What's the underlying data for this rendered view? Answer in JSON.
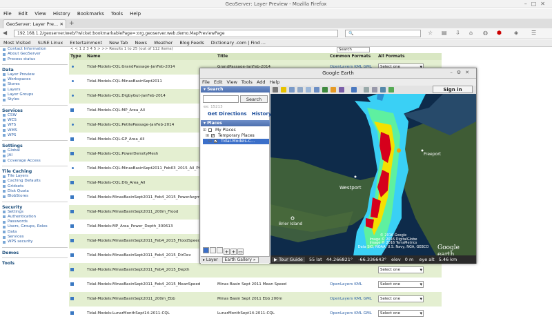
{
  "browser": {
    "window_title": "GeoServer: Layer Preview - Mozilla Firefox",
    "menu": [
      "File",
      "Edit",
      "View",
      "History",
      "Bookmarks",
      "Tools",
      "Help"
    ],
    "tab_label": "GeoServer: Layer Pre...",
    "url": "192.168.1.2/geoserver/web/?wicket:bookmarkablePage=:org.geoserver.web.demo.MapPreviewPage",
    "bookmarks": [
      "Most Visited",
      "SUSE Linux",
      "Entertainment",
      "New Tab",
      "News",
      "Weather",
      "Blog Feeds",
      "Dictionary .com | Find ..."
    ]
  },
  "sidebar": {
    "top_items": [
      "Contact Information",
      "About GeoServer",
      "Process status"
    ],
    "sections": [
      {
        "title": "Data",
        "items": [
          "Layer Preview",
          "Workspaces",
          "Stores",
          "Layers",
          "Layer Groups",
          "Styles"
        ]
      },
      {
        "title": "Services",
        "items": [
          "CSW",
          "WCS",
          "WFS",
          "WMS",
          "WPS"
        ]
      },
      {
        "title": "Settings",
        "items": [
          "Global",
          "JAI",
          "Coverage Access"
        ]
      },
      {
        "title": "Tile Caching",
        "items": [
          "Tile Layers",
          "Caching Defaults",
          "Gridsets",
          "Disk Quota",
          "BlobStores"
        ]
      },
      {
        "title": "Security",
        "items": [
          "Settings",
          "Authentication",
          "Passwords",
          "Users, Groups, Roles",
          "Data",
          "Services",
          "WPS security"
        ]
      },
      {
        "title": "Demos",
        "items": []
      },
      {
        "title": "Tools",
        "items": []
      }
    ]
  },
  "table": {
    "pager": "< < 1 2 3 4 5 > >> Results 1 to 25 (out of 112 items)",
    "search_label": "Search",
    "headers": {
      "type": "Type",
      "name": "Name",
      "title": "Title",
      "common": "Common Formats",
      "all": "All Formats"
    },
    "select_label": "Select one",
    "rows": [
      {
        "type": "point",
        "name": "Tidal-Models-CQL:GrandPassage-JanFeb-2014",
        "title": "GrandPassage-JanFeb-2014",
        "links": "OpenLayers KML GML"
      },
      {
        "type": "point",
        "name": "Tidal-Models-CQL:MinasBasinSept2011",
        "title": "",
        "links": ""
      },
      {
        "type": "point",
        "name": "Tidal-Models-CQL:DigbyGut-JanFeb-2014",
        "title": "",
        "links": ""
      },
      {
        "type": "polygon",
        "name": "Tidal-Models-CQL:MP_Area_All",
        "title": "",
        "links": ""
      },
      {
        "type": "point",
        "name": "Tidal-Models-CQL:PetitePassage-JanFeb-2014",
        "title": "",
        "links": ""
      },
      {
        "type": "polygon",
        "name": "Tidal-Models-CQL:GP_Area_All",
        "title": "",
        "links": ""
      },
      {
        "type": "polygon",
        "name": "Tidal-Models-CQL:PowerDensityMesh",
        "title": "",
        "links": ""
      },
      {
        "type": "point",
        "name": "Tidal-Models-CQL:MinasBasinSept2011_Feb03_2015_All_Pts",
        "title": "",
        "links": ""
      },
      {
        "type": "polygon",
        "name": "Tidal-Models-CQL:DG_Area_All",
        "title": "",
        "links": ""
      },
      {
        "type": "polygon",
        "name": "Tidal-Models:MinasBasinSept2011_Feb4_2015_PowerAvgm",
        "title": "",
        "links": ""
      },
      {
        "type": "polygon",
        "name": "Tidal-Models:MinasBasinSept2011_200m_Flood",
        "title": "",
        "links": ""
      },
      {
        "type": "polygon",
        "name": "Tidal-Models:MP_Area_Power_Depth_300613",
        "title": "",
        "links": ""
      },
      {
        "type": "polygon",
        "name": "Tidal-Models:MinasBasinSept2011_Feb4_2015_FloodSpeed",
        "title": "",
        "links": ""
      },
      {
        "type": "polygon",
        "name": "Tidal-Models:MinasBasinSept2011_Feb4_2015_DirDev",
        "title": "",
        "links": ""
      },
      {
        "type": "polygon",
        "name": "Tidal-Models:MinasBasinSept2011_Feb4_2015_Depth",
        "title": "",
        "links": ""
      },
      {
        "type": "polygon",
        "name": "Tidal-Models:MinasBasinSept2011_Feb4_2015_MeanSpeed",
        "title": "Minas Basin Sept 2011 Mean Speed",
        "links": "OpenLayers KML"
      },
      {
        "type": "polygon",
        "name": "Tidal-Models:MinasBasinSept2011_200m_Ebb",
        "title": "Minas Basin Sept 2011 Ebb 200m",
        "links": "OpenLayers KML GML"
      },
      {
        "type": "polygon",
        "name": "Tidal-Models:LunarMonthSept14-2011-CQL",
        "title": "LunarMonthSept14-2011-CQL",
        "links": "OpenLayers KML GML"
      }
    ]
  },
  "earth": {
    "title": "Google Earth",
    "menu": [
      "File",
      "Edit",
      "View",
      "Tools",
      "Add",
      "Help"
    ],
    "sign_in": "Sign in",
    "search_panel": "Search",
    "search_button": "Search",
    "search_example": "ex: 15213",
    "get_directions": "Get Directions",
    "history": "History",
    "places_panel": "Places",
    "places": [
      {
        "label": "My Places",
        "checked": false,
        "selected": false
      },
      {
        "label": "Temporary Places",
        "checked": true,
        "selected": false
      },
      {
        "label": "Tidal-Models-C...",
        "checked": true,
        "selected": true
      }
    ],
    "layers_tab": "Layer",
    "gallery_tab": "Earth Gallery",
    "map_labels": [
      "Westport",
      "Freeport",
      "Brier Island"
    ],
    "attribution": [
      "© 2016 Google",
      "Image © 2016 DigitalGlobe",
      "Image © 2016 TerraMetrics",
      "Data SIO, NOAA, U.S. Navy, NGA, GEBCO"
    ],
    "logo": "Google earth",
    "tour_guide": "Tour Guide",
    "status": {
      "lat": "44.266821°",
      "lon": "-66.336643°",
      "elev": "elev",
      "m": "0 m",
      "eye": "eye alt",
      "eye_val": "5.46 km",
      "prefix": "55 lat"
    }
  },
  "colors": {
    "table_alt": "#e4efd1",
    "header": "#d9e7c3",
    "link": "#2b5fa6",
    "heat_red": "#d6001c",
    "heat_yellow": "#f4e000",
    "heat_cyan": "#3ad0f5"
  }
}
